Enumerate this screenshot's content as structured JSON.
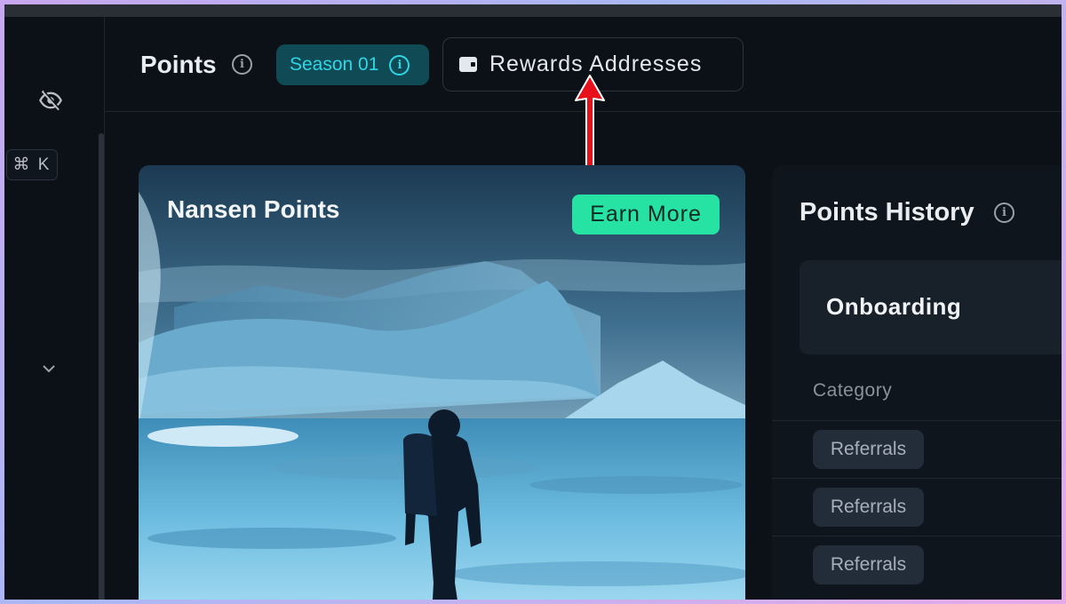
{
  "sidebar": {
    "hide_icon": "eye-slash-icon",
    "shortcut": "⌘ K",
    "expand_icon": "chevron-down-icon"
  },
  "header": {
    "title": "Points",
    "season_label": "Season 01",
    "rewards_button_label": "Rewards Addresses"
  },
  "hero": {
    "title": "Nansen Points",
    "earn_button_label": "Earn More"
  },
  "history": {
    "title": "Points History",
    "tab_label": "Onboarding",
    "column_header": "Category",
    "rows": [
      {
        "category": "Referrals"
      },
      {
        "category": "Referrals"
      },
      {
        "category": "Referrals"
      }
    ]
  },
  "colors": {
    "accent_cyan": "#2fd6e6",
    "accent_green": "#27e3a3",
    "annotation_arrow": "#e8101a"
  }
}
